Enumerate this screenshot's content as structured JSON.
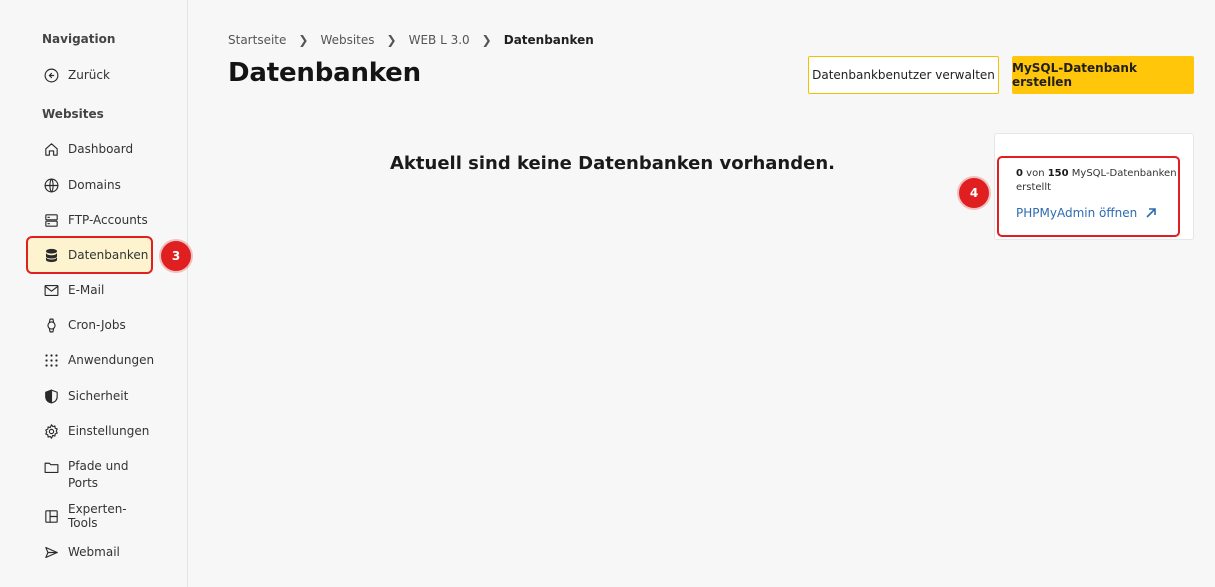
{
  "sidebar": {
    "nav_heading": "Navigation",
    "back_label": "Zurück",
    "websites_heading": "Websites",
    "items": [
      {
        "label": "Dashboard",
        "icon": "home-icon"
      },
      {
        "label": "Domains",
        "icon": "globe-icon"
      },
      {
        "label": "FTP-Accounts",
        "icon": "server-icon"
      },
      {
        "label": "Datenbanken",
        "icon": "database-icon"
      },
      {
        "label": "E-Mail",
        "icon": "mail-icon"
      },
      {
        "label": "Cron-Jobs",
        "icon": "watch-icon"
      },
      {
        "label": "Anwendungen",
        "icon": "grid-dots-icon"
      },
      {
        "label": "Sicherheit",
        "icon": "shield-icon"
      },
      {
        "label": "Einstellungen",
        "icon": "gear-icon"
      },
      {
        "label": "Pfade und",
        "label2": "Ports",
        "icon": "folder-icon"
      },
      {
        "label": "Experten-Tools",
        "icon": "layout-icon"
      },
      {
        "label": "Webmail",
        "icon": "send-icon"
      }
    ]
  },
  "breadcrumb": [
    "Startseite",
    "Websites",
    "WEB L 3.0",
    "Datenbanken"
  ],
  "page": {
    "title": "Datenbanken",
    "btn_manage_users": "Datenbankbenutzer verwalten",
    "btn_create_mysql": "MySQL-Datenbank erstellen",
    "empty_message": "Aktuell sind keine Datenbanken vorhanden."
  },
  "info": {
    "count": "0",
    "count_text": "von",
    "total": "150",
    "count_suffix": "MySQL-Datenbanken erstellt",
    "link": "PHPMyAdmin öffnen"
  },
  "markers": {
    "m3": "3",
    "m4": "4"
  },
  "colors": {
    "accent": "#ffc60a",
    "highlight": "#e02020",
    "link": "#2b6cb0"
  }
}
